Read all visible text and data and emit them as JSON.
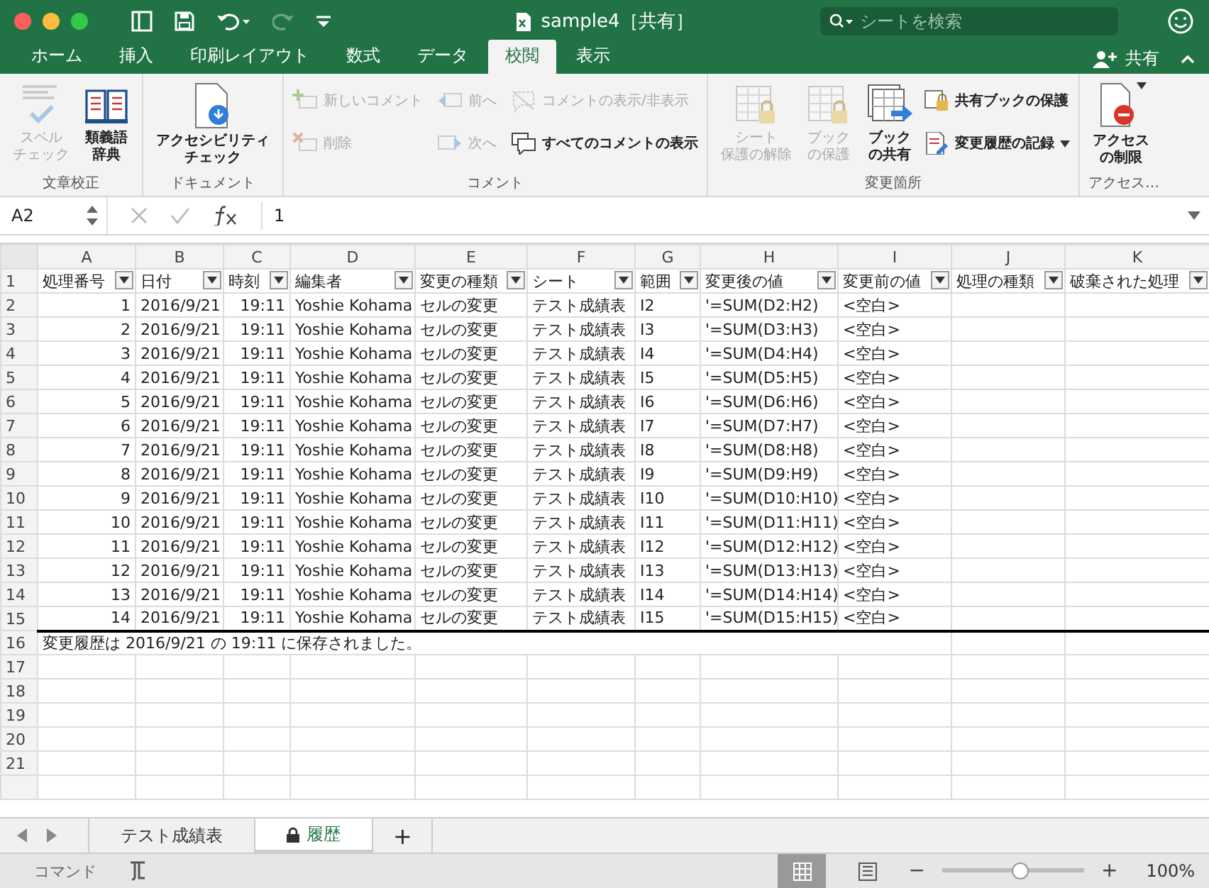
{
  "window": {
    "title": "sample4［共有］",
    "search_placeholder": "シートを検索"
  },
  "ribbon_tabs": [
    {
      "label": "ホーム",
      "selected": false
    },
    {
      "label": "挿入",
      "selected": false
    },
    {
      "label": "印刷レイアウト",
      "selected": false
    },
    {
      "label": "数式",
      "selected": false
    },
    {
      "label": "データ",
      "selected": false
    },
    {
      "label": "校閲",
      "selected": true
    },
    {
      "label": "表示",
      "selected": false
    }
  ],
  "share_label": "共有",
  "ribbon_groups": [
    {
      "label": "文章校正",
      "buttons": [
        {
          "kind": "large",
          "label_lines": [
            "スペル",
            "チェック"
          ],
          "disabled": true
        },
        {
          "kind": "large",
          "label_lines": [
            "類義語",
            "辞典"
          ],
          "disabled": false
        }
      ]
    },
    {
      "label": "ドキュメント",
      "buttons": [
        {
          "kind": "large",
          "label_lines": [
            "アクセシビリティ",
            "チェック"
          ],
          "disabled": false
        }
      ]
    },
    {
      "label": "コメント",
      "buttons": [
        {
          "kind": "small",
          "label_lines": [
            "新しいコメント"
          ],
          "disabled": true
        },
        {
          "kind": "small",
          "label_lines": [
            "削除"
          ],
          "disabled": true
        },
        {
          "kind": "small",
          "label_lines": [
            "前へ"
          ],
          "disabled": true
        },
        {
          "kind": "small",
          "label_lines": [
            "次へ"
          ],
          "disabled": true
        },
        {
          "kind": "small",
          "label_lines": [
            "コメントの表示/非表示"
          ],
          "disabled": true
        },
        {
          "kind": "small",
          "label_lines": [
            "すべてのコメントの表示"
          ],
          "disabled": false
        }
      ]
    },
    {
      "label": "変更箇所",
      "buttons": [
        {
          "kind": "large",
          "label_lines": [
            "シート",
            "保護の解除"
          ],
          "disabled": true
        },
        {
          "kind": "large",
          "label_lines": [
            "ブック",
            "の保護"
          ],
          "disabled": true
        },
        {
          "kind": "large",
          "label_lines": [
            "ブック",
            "の共有"
          ],
          "disabled": false
        },
        {
          "kind": "small",
          "label_lines": [
            "共有ブックの保護"
          ],
          "disabled": false
        },
        {
          "kind": "small",
          "label_lines": [
            "変更履歴の記録"
          ],
          "disabled": false,
          "menu": true
        }
      ]
    },
    {
      "label": "アクセス…",
      "buttons": [
        {
          "kind": "large",
          "label_lines": [
            "アクセス",
            "の制限"
          ],
          "disabled": false,
          "menu": true
        }
      ]
    }
  ],
  "formula_bar": {
    "name_box": "A2",
    "formula": "1"
  },
  "columns": [
    "A",
    "B",
    "C",
    "D",
    "E",
    "F",
    "G",
    "H",
    "I",
    "J",
    "K"
  ],
  "header_row": [
    "処理番号",
    "日付",
    "時刻",
    "編集者",
    "変更の種類",
    "シート",
    "範囲",
    "変更後の値",
    "変更前の値",
    "処理の種類",
    "破棄された処理"
  ],
  "rows": [
    [
      "1",
      "2016/9/21",
      "19:11",
      "Yoshie Kohama",
      "セルの変更",
      "テスト成績表",
      "I2",
      "'=SUM(D2:H2)",
      "<空白>"
    ],
    [
      "2",
      "2016/9/21",
      "19:11",
      "Yoshie Kohama",
      "セルの変更",
      "テスト成績表",
      "I3",
      "'=SUM(D3:H3)",
      "<空白>"
    ],
    [
      "3",
      "2016/9/21",
      "19:11",
      "Yoshie Kohama",
      "セルの変更",
      "テスト成績表",
      "I4",
      "'=SUM(D4:H4)",
      "<空白>"
    ],
    [
      "4",
      "2016/9/21",
      "19:11",
      "Yoshie Kohama",
      "セルの変更",
      "テスト成績表",
      "I5",
      "'=SUM(D5:H5)",
      "<空白>"
    ],
    [
      "5",
      "2016/9/21",
      "19:11",
      "Yoshie Kohama",
      "セルの変更",
      "テスト成績表",
      "I6",
      "'=SUM(D6:H6)",
      "<空白>"
    ],
    [
      "6",
      "2016/9/21",
      "19:11",
      "Yoshie Kohama",
      "セルの変更",
      "テスト成績表",
      "I7",
      "'=SUM(D7:H7)",
      "<空白>"
    ],
    [
      "7",
      "2016/9/21",
      "19:11",
      "Yoshie Kohama",
      "セルの変更",
      "テスト成績表",
      "I8",
      "'=SUM(D8:H8)",
      "<空白>"
    ],
    [
      "8",
      "2016/9/21",
      "19:11",
      "Yoshie Kohama",
      "セルの変更",
      "テスト成績表",
      "I9",
      "'=SUM(D9:H9)",
      "<空白>"
    ],
    [
      "9",
      "2016/9/21",
      "19:11",
      "Yoshie Kohama",
      "セルの変更",
      "テスト成績表",
      "I10",
      "'=SUM(D10:H10)",
      "<空白>"
    ],
    [
      "10",
      "2016/9/21",
      "19:11",
      "Yoshie Kohama",
      "セルの変更",
      "テスト成績表",
      "I11",
      "'=SUM(D11:H11)",
      "<空白>"
    ],
    [
      "11",
      "2016/9/21",
      "19:11",
      "Yoshie Kohama",
      "セルの変更",
      "テスト成績表",
      "I12",
      "'=SUM(D12:H12)",
      "<空白>"
    ],
    [
      "12",
      "2016/9/21",
      "19:11",
      "Yoshie Kohama",
      "セルの変更",
      "テスト成績表",
      "I13",
      "'=SUM(D13:H13)",
      "<空白>"
    ],
    [
      "13",
      "2016/9/21",
      "19:11",
      "Yoshie Kohama",
      "セルの変更",
      "テスト成績表",
      "I14",
      "'=SUM(D14:H14)",
      "<空白>"
    ],
    [
      "14",
      "2016/9/21",
      "19:11",
      "Yoshie Kohama",
      "セルの変更",
      "テスト成績表",
      "I15",
      "'=SUM(D15:H15)",
      "<空白>"
    ]
  ],
  "note": "変更履歴は 2016/9/21 の 19:11 に保存されました。",
  "row_numbers": [
    "1",
    "2",
    "3",
    "4",
    "5",
    "6",
    "7",
    "8",
    "9",
    "10",
    "11",
    "12",
    "13",
    "14",
    "15",
    "16",
    "17",
    "18",
    "19",
    "20",
    "21"
  ],
  "sheet_tabs": [
    {
      "label": "テスト成績表",
      "selected": false,
      "locked": false
    },
    {
      "label": "履歴",
      "selected": true,
      "locked": true
    }
  ],
  "add_sheet": "+",
  "status_bar": {
    "mode": "コマンド",
    "zoom": "100%",
    "zoom_minus": "−",
    "zoom_plus": "+",
    "level": 0.55
  }
}
